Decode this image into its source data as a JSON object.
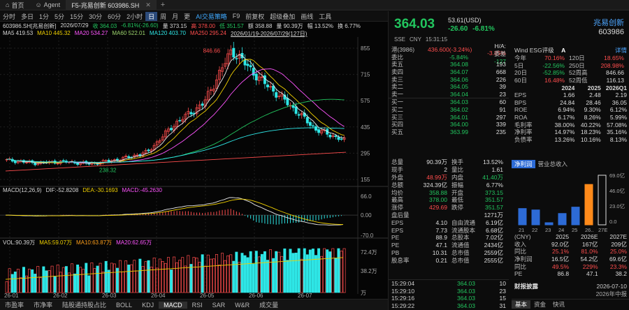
{
  "tabs": {
    "home": "首页",
    "agent": "Agent",
    "stock": "F5-兆易创新 603986.SH",
    "plus": "+"
  },
  "toolbar": {
    "items": [
      "分时",
      "多日",
      "1分",
      "5分",
      "15分",
      "30分",
      "60分",
      "2小时",
      "日",
      "周",
      "月",
      "更",
      "AI交易策略",
      "F9",
      "前复权",
      "超级叠加",
      "画线",
      "工具"
    ],
    "active": "日"
  },
  "chart": {
    "info1": {
      "code": "603986.SH[兆易创新]",
      "date": "2026/07/29",
      "open": "开 390.00",
      "high": "高 378.00",
      "low": "低 351.57",
      "close": "收 364.03",
      "change": "-6.81%(-26.60)",
      "vol": "量 373.15",
      "amount": "额 358.88",
      "turn": "量 90.39万",
      "pct": "幅 13.52%",
      "rate": "换 6.77%"
    },
    "ma": {
      "ma5": "MA5 419.53",
      "ma10": "MA10 445.32",
      "ma20": "MA20 534.27",
      "ma60": "MA60 522.01",
      "ma120": "MA120 403.70",
      "ma250": "MA250 295.24"
    },
    "range": "2026/01/19-2026/07/29(127日)",
    "high_label": "846.66",
    "low_label": "238.32",
    "yticks": [
      "855",
      "715",
      "575",
      "435",
      "295",
      "155"
    ],
    "macd_label": "MACD(12,26,9)",
    "macd_vals": {
      "dif": "DIF:-52.8208",
      "dea": "DEA:-30.1693",
      "macd": "MACD:-45.2630"
    },
    "macd_ticks": [
      "66.0",
      "0.00",
      "-70.0"
    ],
    "vol_label": "VOL:90.39万",
    "vol_vals": {
      "ma5": "MA5:59.07万",
      "ma10": "MA10:63.87万",
      "ma20": "MA20:62.65万"
    },
    "vol_ticks": [
      "72.4万",
      "38.2万",
      "万"
    ],
    "xlabels": [
      "26-01",
      "26-02",
      "26-03",
      "26-04",
      "26-05",
      "26-06",
      "26-07"
    ]
  },
  "chart_data": {
    "type": "candlestick",
    "title": "603986.SH 兆易创新 日K",
    "x": [
      "26-01",
      "26-02",
      "26-03",
      "26-04",
      "26-05",
      "26-06",
      "26-07"
    ],
    "close": [
      258,
      242,
      250,
      238,
      262,
      300,
      455,
      560,
      846,
      690,
      560,
      420,
      364
    ],
    "ylim": [
      155,
      855
    ],
    "macd_ylim": [
      -70,
      66
    ],
    "volume_max": "72.4万"
  },
  "quote": {
    "price": "364.03",
    "usd": "53.61(USD)",
    "change": "-26.60",
    "pct": "-6.81%",
    "name": "兆易创新",
    "code": "603986",
    "market": "SSE",
    "currency": "CNY",
    "time": "15:31:15",
    "hk_label": "港(3986)",
    "hk_value": "436.600(-3.24%)",
    "ha_label": "H/A:",
    "ha_value": "-3.85%",
    "weibi_label": "委比",
    "weibi": "-5.84%",
    "weicha_label": "委差",
    "weicha": "-127"
  },
  "orderbook": {
    "asks": [
      {
        "label": "卖五",
        "price": "364.08",
        "vol": "193"
      },
      {
        "label": "卖四",
        "price": "364.07",
        "vol": "668"
      },
      {
        "label": "卖三",
        "price": "364.06",
        "vol": "226"
      },
      {
        "label": "卖二",
        "price": "364.05",
        "vol": "39"
      },
      {
        "label": "卖一",
        "price": "364.04",
        "vol": "23"
      }
    ],
    "bids": [
      {
        "label": "买一",
        "price": "364.03",
        "vol": "60"
      },
      {
        "label": "买二",
        "price": "364.02",
        "vol": "91"
      },
      {
        "label": "买三",
        "price": "364.01",
        "vol": "297"
      },
      {
        "label": "买四",
        "price": "364.00",
        "vol": "339"
      },
      {
        "label": "买五",
        "price": "363.99",
        "vol": "235"
      }
    ]
  },
  "stats": [
    {
      "a": "总量",
      "b": "90.39万",
      "c": "换手",
      "d": "13.52%"
    },
    {
      "a": "现手",
      "b": "2",
      "c": "量比",
      "d": "1.61"
    },
    {
      "a": "外盘",
      "b": "48.99万",
      "c": "内盘",
      "d": "41.40万"
    },
    {
      "a": "总额",
      "b": "324.39亿",
      "c": "振幅",
      "d": "6.77%"
    },
    {
      "a": "均价",
      "b": "358.88",
      "c": "开盘",
      "d": "373.15"
    },
    {
      "a": "最高",
      "b": "378.00",
      "c": "最低",
      "d": "351.57"
    },
    {
      "a": "涨停",
      "b": "429.69",
      "c": "跌停",
      "d": "351.57"
    },
    {
      "a": "盘后量",
      "b": "",
      "c": "",
      "d": "1271万"
    },
    {
      "a": "EPS",
      "b": "4.10",
      "c": "自由流通",
      "d": "6.19亿"
    },
    {
      "a": "EPS",
      "b": "7.73",
      "c": "流通股本",
      "d": "6.68亿"
    },
    {
      "a": "PE",
      "b": "88.9",
      "c": "总股本",
      "d": "7.02亿"
    },
    {
      "a": "PE",
      "b": "47.1",
      "c": "流通值",
      "d": "2434亿"
    },
    {
      "a": "PB",
      "b": "10.31",
      "c": "总市值",
      "d": "2559亿"
    },
    {
      "a": "股息率",
      "b": "0.21",
      "c": "总市值",
      "d": "2555亿"
    }
  ],
  "ticks": [
    {
      "t": "15:29:04",
      "p": "364.03",
      "v": "10"
    },
    {
      "t": "15:29:10",
      "p": "364.03",
      "v": "23"
    },
    {
      "t": "15:29:16",
      "p": "364.03",
      "v": "15"
    },
    {
      "t": "15:29:22",
      "p": "364.03",
      "v": "31"
    }
  ],
  "fund": {
    "title": "Wind ESG评级",
    "rating": "A",
    "link": "详情",
    "perf": [
      {
        "a": "今年",
        "b": "70.16%",
        "c": "120日",
        "d": "18.65%"
      },
      {
        "a": "5日",
        "b": "-22.56%",
        "c": "250日",
        "d": "208.98%"
      },
      {
        "a": "20日",
        "b": "-52.85%",
        "c": "52周高",
        "d": "846.66"
      },
      {
        "a": "60日",
        "b": "16.48%",
        "c": "52周低",
        "d": "116.13"
      }
    ],
    "hdr": {
      "a": "",
      "b": "2024",
      "c": "2025",
      "d": "2026Q1"
    },
    "metrics": [
      {
        "a": "EPS",
        "b": "1.66",
        "c": "2.48",
        "d": "2.19"
      },
      {
        "a": "BPS",
        "b": "24.84",
        "c": "28.46",
        "d": "36.05"
      },
      {
        "a": "ROE",
        "b": "6.94%",
        "c": "9.30%",
        "d": "6.12%"
      },
      {
        "a": "ROA",
        "b": "6.17%",
        "c": "8.26%",
        "d": "5.99%"
      },
      {
        "a": "毛利率",
        "b": "38.00%",
        "c": "40.22%",
        "d": "57.08%"
      },
      {
        "a": "净利率",
        "b": "14.97%",
        "c": "18.23%",
        "d": "35.16%"
      },
      {
        "a": "负债率",
        "b": "13.26%",
        "c": "10.16%",
        "d": "8.13%"
      }
    ],
    "subtabs": [
      "净利润",
      "营业总收入"
    ],
    "active_subtab": "净利润",
    "bar_ylabels": [
      "69.0亿",
      "46.0亿",
      "23.0亿",
      "0.0"
    ],
    "bar_xlabels": [
      "21",
      "22",
      "23",
      "24",
      "25",
      "26..",
      "27E"
    ],
    "bar_values": [
      23,
      21,
      3,
      16,
      25,
      57,
      70
    ],
    "est_hdr": {
      "a": "(CNY)",
      "b": "2025",
      "c": "2026E",
      "d": "2027E"
    },
    "est": [
      {
        "a": "收入",
        "b": "92.0亿",
        "c": "167亿",
        "d": "209亿"
      },
      {
        "a": "同比",
        "b": "25.1%",
        "c": "81.0%",
        "d": "25.0%"
      },
      {
        "a": "净利润",
        "b": "16.5亿",
        "c": "54.2亿",
        "d": "69.6亿"
      },
      {
        "a": "同比",
        "b": "49.5%",
        "c": "229%",
        "d": "23.3%"
      },
      {
        "a": "PE",
        "b": "86.8",
        "c": "47.1",
        "d": "38.2"
      }
    ],
    "news_title": "财报披露",
    "news_date": "2026-07-10",
    "news_sub": "2026年中报",
    "bottom_tabs": [
      "基本",
      "资金",
      "快讯"
    ],
    "active_bottom": "基本"
  },
  "indicators": {
    "items": [
      "市盈率",
      "市净率",
      "陆股通持股占比",
      "BOLL",
      "KDJ",
      "MACD",
      "RSI",
      "SAR",
      "W&R",
      "成交量"
    ],
    "active": "MACD"
  },
  "colors": {
    "up": "#ff4d4d",
    "down": "#22c55e",
    "accent": "#4da6ff",
    "macd_bar_neg": "#2ee6e6",
    "vol_bar": "#2ee6e6"
  }
}
